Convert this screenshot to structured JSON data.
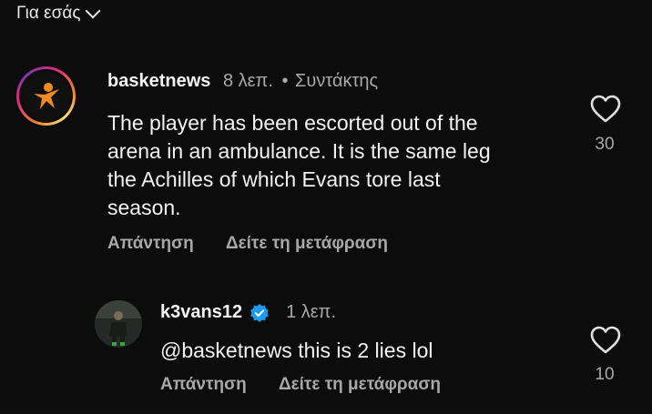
{
  "header": {
    "filter_label": "Για εσάς"
  },
  "comments": [
    {
      "username": "basketnews",
      "time": "8 λεπ.",
      "separator": "•",
      "role": "Συντάκτης",
      "text_lines": [
        "The player has been escorted out of the",
        "arena in an ambulance. It is the same leg",
        "the Achilles of which Evans tore last",
        "season."
      ],
      "reply_label": "Απάντηση",
      "translate_label": "Δείτε τη μετάφραση",
      "likes": "30"
    },
    {
      "username": "k3vans12",
      "time": "1 λεπ.",
      "text": "@basketnews this is 2 lies lol",
      "reply_label": "Απάντηση",
      "translate_label": "Δείτε τη μετάφραση",
      "likes": "10"
    }
  ],
  "colors": {
    "background": "#0c0c0c",
    "secondary_text": "#a8a8a8",
    "verified": "#1d9bf0",
    "logo_orange": "#f28c1e"
  }
}
